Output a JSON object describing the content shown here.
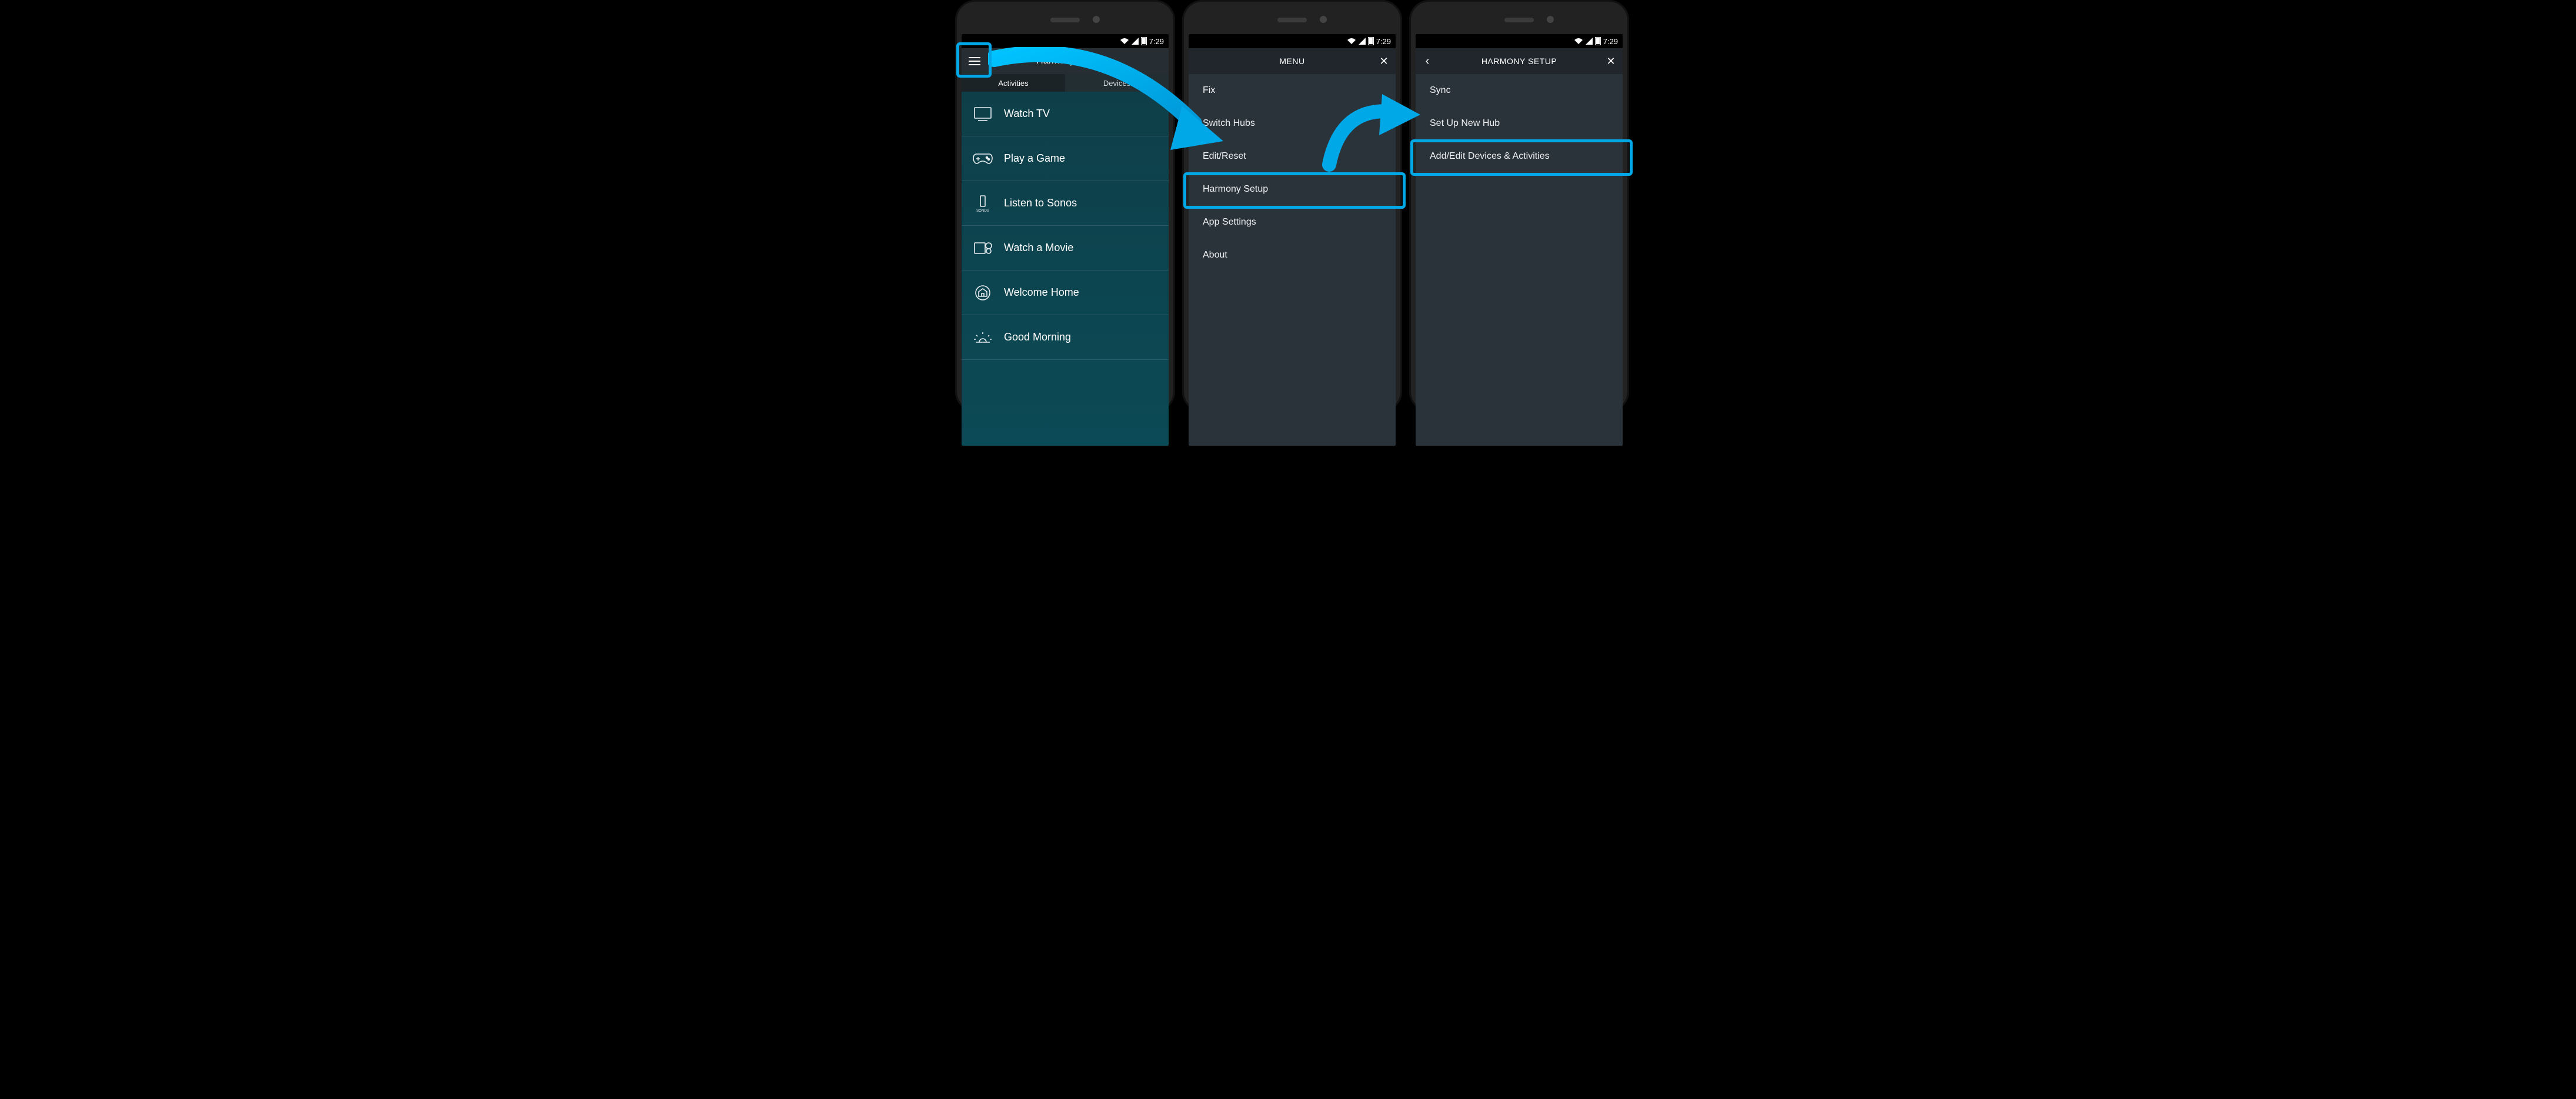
{
  "status": {
    "time": "7:29"
  },
  "screen1": {
    "title": "Harmony Hub",
    "tabs": {
      "activities": "Activities",
      "devices": "Devices"
    },
    "items": [
      {
        "label": "Watch TV"
      },
      {
        "label": "Play a Game"
      },
      {
        "label": "Listen to Sonos"
      },
      {
        "label": "Watch a Movie"
      },
      {
        "label": "Welcome Home"
      },
      {
        "label": "Good Morning"
      }
    ]
  },
  "screen2": {
    "title": "MENU",
    "items": [
      {
        "label": "Fix"
      },
      {
        "label": "Switch Hubs"
      },
      {
        "label": "Edit/Reset"
      },
      {
        "label": "Harmony Setup"
      },
      {
        "label": "App Settings"
      },
      {
        "label": "About"
      }
    ]
  },
  "screen3": {
    "title": "HARMONY SETUP",
    "items": [
      {
        "label": "Sync"
      },
      {
        "label": "Set Up New Hub"
      },
      {
        "label": "Add/Edit Devices & Activities"
      }
    ]
  }
}
